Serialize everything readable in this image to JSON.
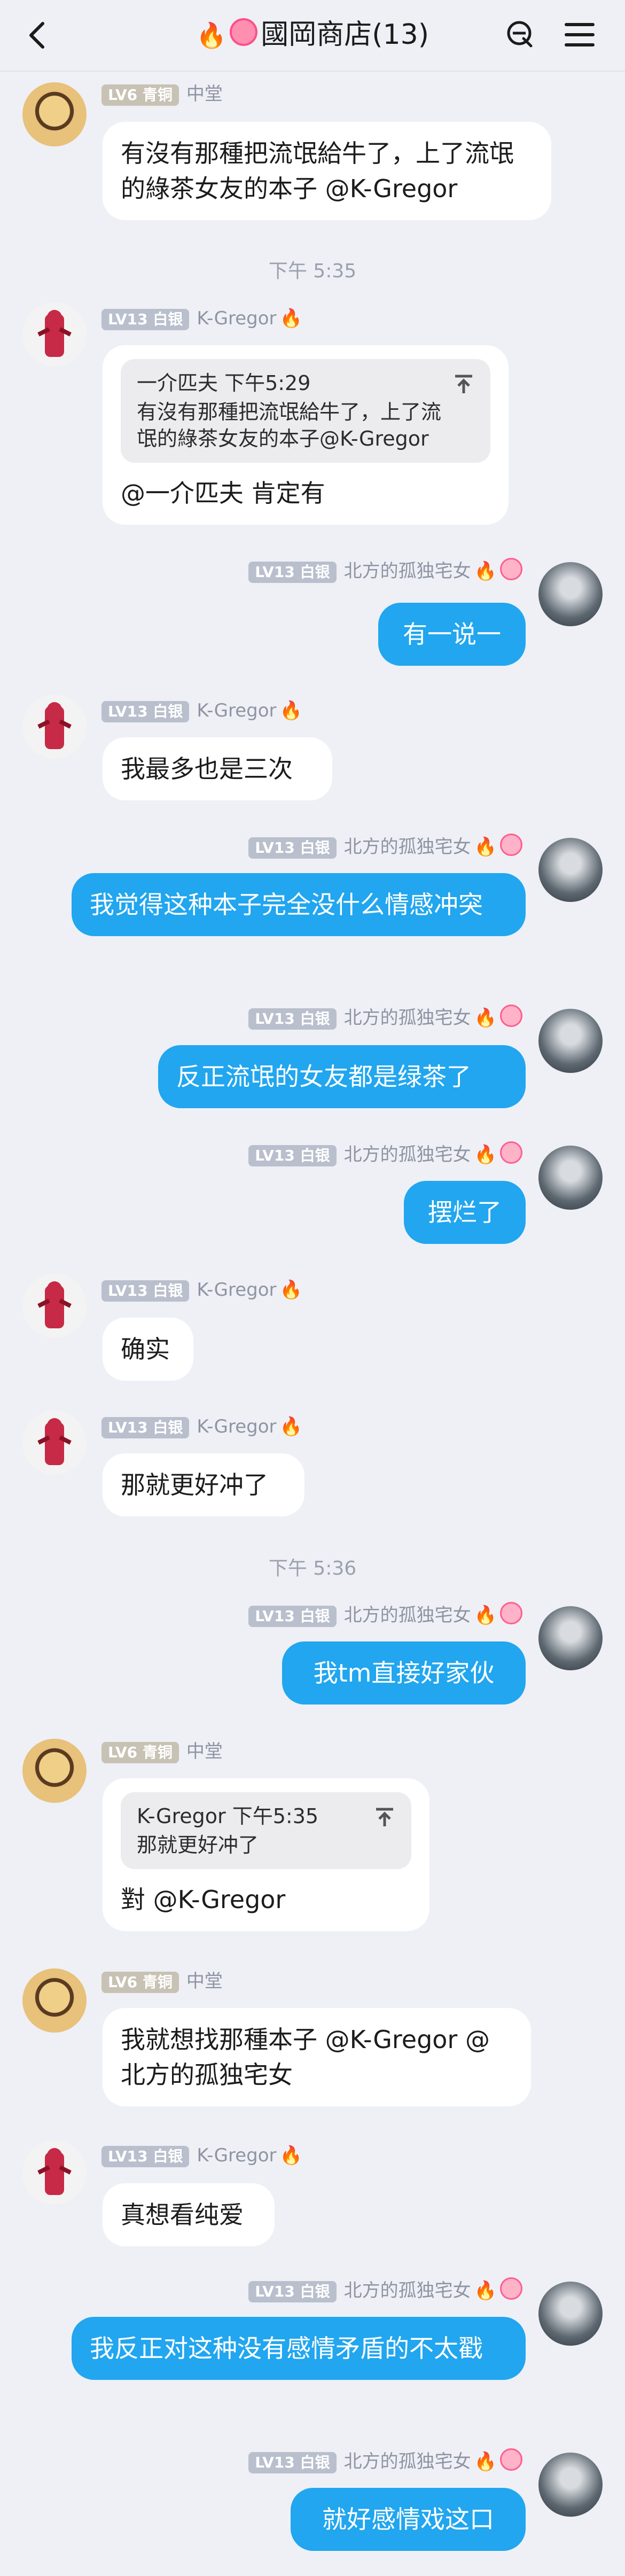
{
  "header": {
    "title": "國岡商店(13)",
    "fire": "🔥"
  },
  "users": {
    "ws": {
      "level": "LV6",
      "rank": "青铜",
      "name": "中堂"
    },
    "kg": {
      "level": "LV13",
      "rank": "白银",
      "name": "K-Gregor",
      "flame": "🔥"
    },
    "me": {
      "level": "LV13",
      "rank": "白银",
      "name": "北方的孤独宅女",
      "flame": "🔥"
    }
  },
  "messages": {
    "m1": {
      "text": "有沒有那種把流氓給牛了，上了流氓的綠茶女友的本子 @K-Gregor"
    },
    "t1": {
      "text": "下午 5:35"
    },
    "m2": {
      "quote_head": "一介匹夫 下午5:29",
      "quote_text": "有沒有那種把流氓給牛了，上了流氓的綠茶女友的本子@K-Gregor",
      "text": "@一介匹夫 肯定有"
    },
    "m3": {
      "text": "有一说一"
    },
    "m4": {
      "text": "我最多也是三次"
    },
    "m5": {
      "text": "我觉得这种本子完全没什么情感冲突"
    },
    "m6": {
      "text": "反正流氓的女友都是绿茶了"
    },
    "m7": {
      "text": "摆烂了"
    },
    "m8": {
      "text": "确实"
    },
    "m9": {
      "text": "那就更好冲了"
    },
    "t2": {
      "text": "下午 5:36"
    },
    "m10": {
      "text": "我tm直接好家伙"
    },
    "m11": {
      "quote_head": "K-Gregor 下午5:35",
      "quote_text": "那就更好冲了",
      "text": "對 @K-Gregor"
    },
    "m12": {
      "text": "我就想找那種本子 @K-Gregor @北方的孤独宅女"
    },
    "m13": {
      "text": "真想看纯爱"
    },
    "m14": {
      "text": "我反正对这种没有感情矛盾的不太戳"
    },
    "m15": {
      "text": "就好感情戏这口"
    }
  }
}
